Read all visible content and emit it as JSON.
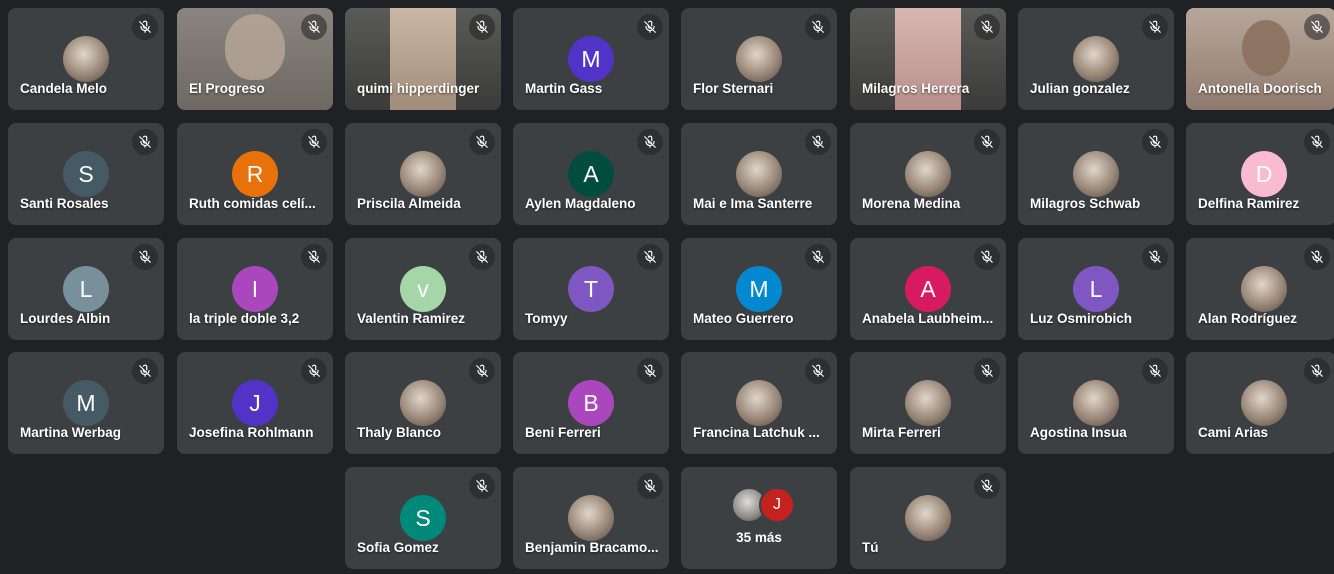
{
  "participants": [
    {
      "name": "Candela Melo",
      "type": "photo"
    },
    {
      "name": "El Progreso",
      "type": "video",
      "variant": "face"
    },
    {
      "name": "quimi hipperdinger",
      "type": "video",
      "variant": "strip"
    },
    {
      "name": "Martin Gass",
      "type": "letter",
      "initial": "M",
      "color": "#5133c7"
    },
    {
      "name": "Flor Sternari",
      "type": "photo"
    },
    {
      "name": "Milagros Herrera",
      "type": "video",
      "variant": "strip-pink"
    },
    {
      "name": "Julian gonzalez",
      "type": "photo"
    },
    {
      "name": "Antonella Doorisch",
      "type": "video",
      "variant": "face2"
    },
    {
      "name": "Santi Rosales",
      "type": "letter",
      "initial": "S",
      "color": "#455a64"
    },
    {
      "name": "Ruth comidas celí...",
      "type": "letter",
      "initial": "R",
      "color": "#e8710a"
    },
    {
      "name": "Priscila Almeida",
      "type": "photo"
    },
    {
      "name": "Aylen Magdaleno",
      "type": "letter",
      "initial": "A",
      "color": "#004d40"
    },
    {
      "name": "Mai e Ima Santerre",
      "type": "photo"
    },
    {
      "name": "Morena Medina",
      "type": "photo"
    },
    {
      "name": "Milagros Schwab",
      "type": "photo"
    },
    {
      "name": "Delfina Ramirez",
      "type": "letter",
      "initial": "D",
      "color": "#f8bbd0"
    },
    {
      "name": "Lourdes Albin",
      "type": "letter",
      "initial": "L",
      "color": "#78909c"
    },
    {
      "name": "la triple doble 3,2",
      "type": "letter",
      "initial": "I",
      "color": "#ab47bc"
    },
    {
      "name": "Valentin Ramirez",
      "type": "letter",
      "initial": "v",
      "color": "#a5d6a7"
    },
    {
      "name": "Tomyy",
      "type": "letter",
      "initial": "T",
      "color": "#7e57c2"
    },
    {
      "name": "Mateo Guerrero",
      "type": "letter",
      "initial": "M",
      "color": "#0288d1"
    },
    {
      "name": "Anabela Laubheim...",
      "type": "letter",
      "initial": "A",
      "color": "#d81b60"
    },
    {
      "name": "Luz Osmirobich",
      "type": "letter",
      "initial": "L",
      "color": "#7e57c2"
    },
    {
      "name": "Alan Rodríguez",
      "type": "photo"
    },
    {
      "name": "Martina Werbag",
      "type": "letter",
      "initial": "M",
      "color": "#455a64"
    },
    {
      "name": "Josefina Rohlmann",
      "type": "letter",
      "initial": "J",
      "color": "#5133c7"
    },
    {
      "name": "Thaly Blanco",
      "type": "photo"
    },
    {
      "name": "Beni Ferreri",
      "type": "letter",
      "initial": "B",
      "color": "#ab47bc"
    },
    {
      "name": "Francina Latchuk ...",
      "type": "photo"
    },
    {
      "name": "Mirta Ferreri",
      "type": "photo"
    },
    {
      "name": "Agostina Insua",
      "type": "photo"
    },
    {
      "name": "Cami Arias",
      "type": "photo"
    },
    {
      "name": "Sofia Gomez",
      "type": "letter",
      "initial": "S",
      "color": "#00897b"
    },
    {
      "name": "Benjamin Bracamo...",
      "type": "photo"
    },
    {
      "name": "35 más",
      "type": "more",
      "initial": "J"
    },
    {
      "name": "Tú",
      "type": "photo",
      "self": true
    }
  ],
  "icons": {
    "mic_off": "mic-off-icon"
  }
}
